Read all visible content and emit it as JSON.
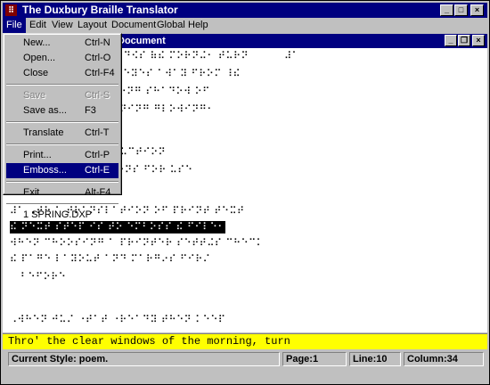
{
  "window": {
    "title": "The Duxbury Braille Translator",
    "icon_glyph": "⠿",
    "controls": {
      "minimize": "_",
      "maximize": "□",
      "close": "×"
    }
  },
  "menubar": [
    "File",
    "Edit",
    "View",
    "Layout",
    "Document",
    "Global",
    "Help"
  ],
  "document": {
    "title": "Document",
    "controls": {
      "minimize": "_",
      "restore": "❐",
      "close": "×"
    },
    "braille_lines": [
      "⠠⠞⠓⠗⠕⠄⠸⠮ ⠉⠇⠑⠜ ⠺⠔⠙⠪⠎ ⠷⠮ ⠍⠕⠗⠝⠬⠂ ⠞⠥⠗⠝          ⠼⠁",
      "⠹⠽ ⠋⠁⠉⠑ ⠁⠝⠙ ⠹⠊⠝⠑ ⠑⠽⠑⠎ ⠁⠺⠁⠽ ⠋⠗⠕⠍ ⠸⠮",
      "  ⠓⠕⠥⠎⠑ ⠁⠝⠙ ⠞⠓⠑ ⠇⠕⠝⠛ ⠎⠓⠁⠙⠕⠺ ⠕⠋",
      "⠞⠓⠑ ⠺⠁⠇⠇⠎ ⠁⠞ ⠑⠧⠑⠝⠊⠝⠛ ⠛⠇⠕⠺⠊⠝⠛⠂",
      "",
      "                ⠠⠊⠝⠞⠗⠕⠙⠥⠉⠞⠊⠕⠝",
      "             ⠎⠥⠛⠛⠑⠎⠞⠊⠕⠝⠎ ⠋⠕⠗ ⠥⠎⠑",
      "",
      "⠼⠁ ⠠⠞⠓ ⠁ ⠞⠗⠁⠝⠎⠇⠁⠞⠊⠕⠝ ⠕⠋ ⠏⠗⠊⠝⠞ ⠞⠑⠭⠞",
      "⠮ ⠝⠑⠭⠞ ⠎⠞⠑⠏ ⠊⠎ ⠞⠕ ⠑⠍⠃⠕⠎⠎ ⠮ ⠋⠊⠇⠑⠂",
      "⠺⠓⠑⠝ ⠉⠓⠕⠕⠎⠊⠝⠛ ⠁ ⠏⠗⠊⠝⠞⠑⠗ ⠎⠑⠞⠞⠬⠎ ⠉⠓⠑⠉⠅",
      "⠮ ⠏⠁⠛⠑ ⠇⠁⠽⠕⠥⠞ ⠁⠝⠙ ⠍⠁⠗⠛⠔⠎ ⠋⠊⠗⠌",
      "   ⠃⠑⠋⠕⠗⠑",
      "",
      "⠠⠺⠓⠑⠝ ⠚⠥⠌ ⠐⠞⠁⠞ ⠐⠗⠑⠁⠙⠽ ⠞⠓⠑⠝ ⠅⠑⠑⠏"
    ],
    "highlighted_line_index": 9
  },
  "print_line": "Thro' the clear windows of the morning, turn",
  "statusbar": {
    "style": "Current Style: poem.",
    "page": "Page:1",
    "line": "Line:10",
    "column": "Column:34"
  },
  "file_menu": {
    "items": [
      {
        "label": "New...",
        "accel": "Ctrl-N",
        "state": "normal"
      },
      {
        "label": "Open...",
        "accel": "Ctrl-O",
        "state": "normal"
      },
      {
        "label": "Close",
        "accel": "Ctrl-F4",
        "state": "normal"
      },
      {
        "sep": true
      },
      {
        "label": "Save",
        "accel": "Ctrl-S",
        "state": "disabled"
      },
      {
        "label": "Save as...",
        "accel": "F3",
        "state": "normal"
      },
      {
        "sep": true
      },
      {
        "label": "Translate",
        "accel": "Ctrl-T",
        "state": "normal"
      },
      {
        "sep": true
      },
      {
        "label": "Print...",
        "accel": "Ctrl-P",
        "state": "normal"
      },
      {
        "label": "Emboss...",
        "accel": "Ctrl-E",
        "state": "selected"
      },
      {
        "sep": true
      },
      {
        "label": "Exit",
        "accel": "Alt-F4",
        "state": "normal"
      },
      {
        "sep": true
      },
      {
        "label": "1 SPRING.DXP",
        "accel": "",
        "state": "normal"
      }
    ]
  },
  "colors": {
    "title_bg": "#000080",
    "print_line_bg": "#ffff00",
    "face": "#c0c0c0"
  }
}
